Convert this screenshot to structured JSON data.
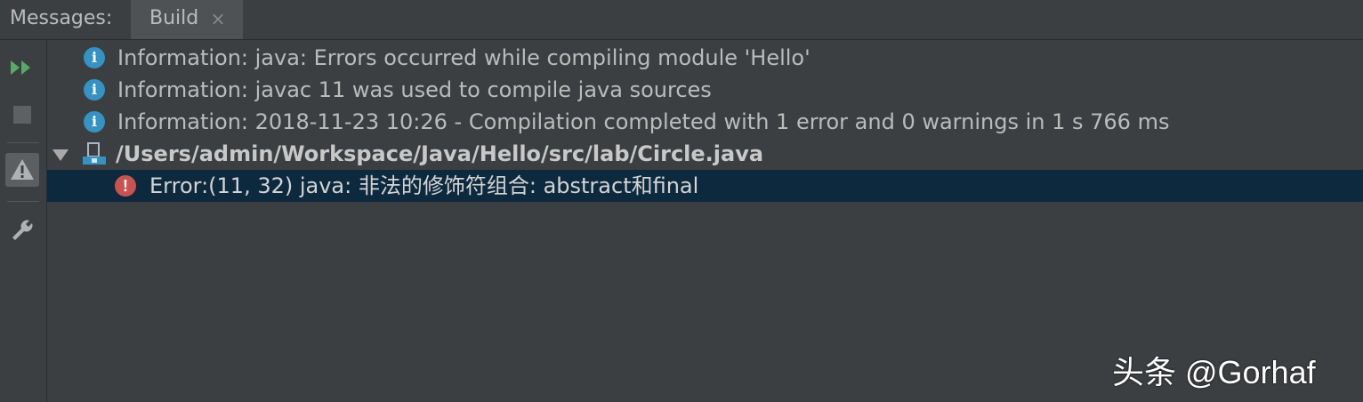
{
  "header": {
    "label": "Messages:",
    "tab_label": "Build",
    "tab_close": "×"
  },
  "toolbar": {
    "rerun_icon": "rerun-icon",
    "stop_icon": "stop-icon",
    "warning_filter_icon": "warning-icon",
    "settings_icon": "wrench-icon"
  },
  "messages": [
    {
      "type": "info",
      "text": "Information: java: Errors occurred while compiling module 'Hello'"
    },
    {
      "type": "info",
      "text": "Information: javac 11 was used to compile java sources"
    },
    {
      "type": "info",
      "text": "Information: 2018-11-23 10:26 - Compilation completed with 1 error and 0 warnings in 1 s 766 ms"
    }
  ],
  "file": {
    "path": "/Users/admin/Workspace/Java/Hello/src/lab/Circle.java",
    "error": "Error:(11, 32)  java: 非法的修饰符组合: abstract和final"
  },
  "icons": {
    "info": "i",
    "error": "!"
  },
  "watermark": "头条 @Gorhaf",
  "colors": {
    "background": "#3c3f41",
    "selection": "#0d293e",
    "info_icon": "#3592c4",
    "error_icon": "#c75450",
    "run_green": "#59a869"
  }
}
